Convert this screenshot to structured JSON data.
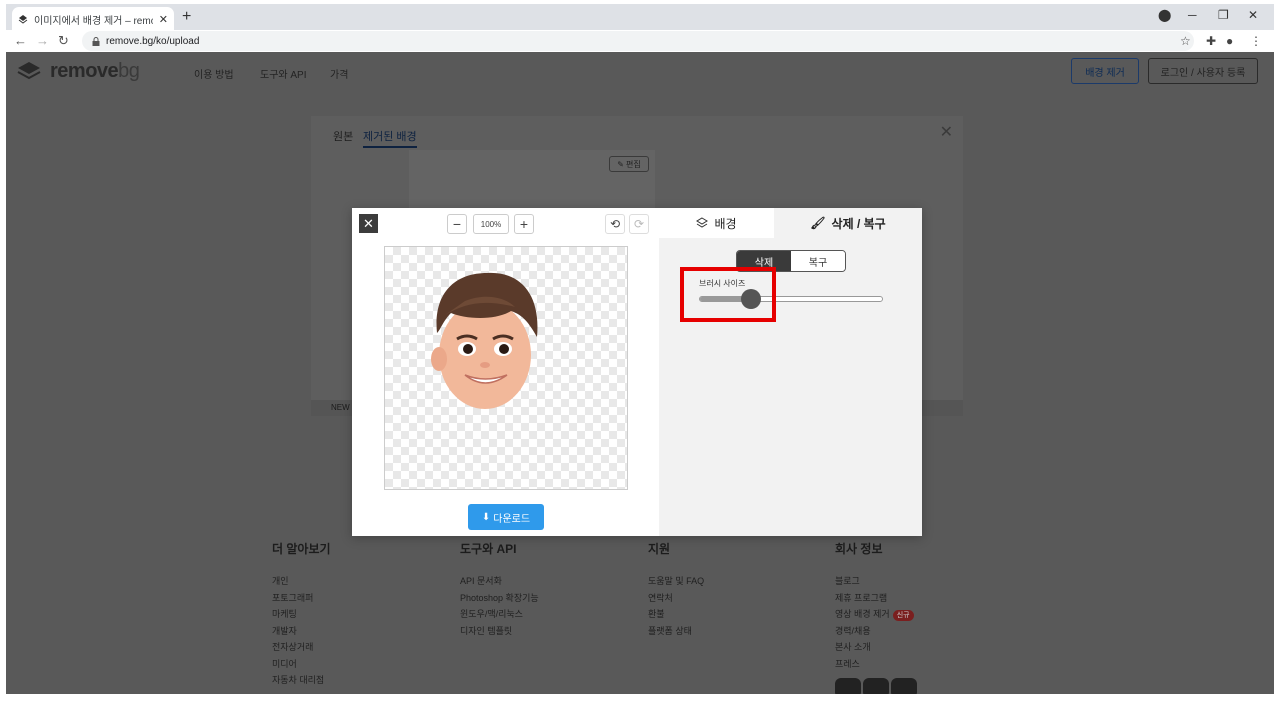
{
  "browser": {
    "tab_title": "이미지에서 배경 제거 – remove",
    "tab_close": "✕",
    "new_tab": "+",
    "url": "remove.bg/ko/upload",
    "window_controls": [
      "─",
      "❐",
      "✕"
    ]
  },
  "header": {
    "logo_text": "remove",
    "logo_suffix": "bg",
    "nav": [
      "이용 방법",
      "도구와 API",
      "가격"
    ],
    "remove_bg_button": "배경 제거",
    "login_button": "로그인 / 사용자 등록"
  },
  "result_card": {
    "tabs": [
      "원본",
      "제거된 배경"
    ],
    "edit_chip": "편집",
    "strip_text": "NEW"
  },
  "editor": {
    "zoom_out": "−",
    "zoom_value": "100%",
    "zoom_in": "+",
    "undo": "⟲",
    "redo": "⟳",
    "download_label": "다운로드",
    "tab_background": "배경",
    "tab_erase_restore": "삭제 / 복구",
    "mode_erase": "삭제",
    "mode_restore": "복구",
    "brush_size_label": "브러시 사이즈",
    "brush_size": 0.28
  },
  "footer": {
    "columns": [
      {
        "title": "더 알아보기",
        "links": [
          "개인",
          "포토그래퍼",
          "마케팅",
          "개발자",
          "전자상거래",
          "미디어",
          "자동차 대리점"
        ]
      },
      {
        "title": "도구와 API",
        "links": [
          "API 문서화",
          "Photoshop 확장기능",
          "윈도우/맥/리눅스",
          "디자인 템플릿"
        ]
      },
      {
        "title": "지원",
        "links": [
          "도움말 및 FAQ",
          "연락처",
          "환불",
          "플랫폼 상태"
        ]
      },
      {
        "title": "회사 정보",
        "links": [
          "블로그",
          "제휴 프로그램",
          "영상 배경 제거",
          "경력/채용",
          "본사 소개",
          "프레스"
        ],
        "badge": "신규"
      }
    ]
  },
  "colors": {
    "accent": "#2f9aeb",
    "highlight": "#e60000",
    "overlay": "#595959"
  }
}
